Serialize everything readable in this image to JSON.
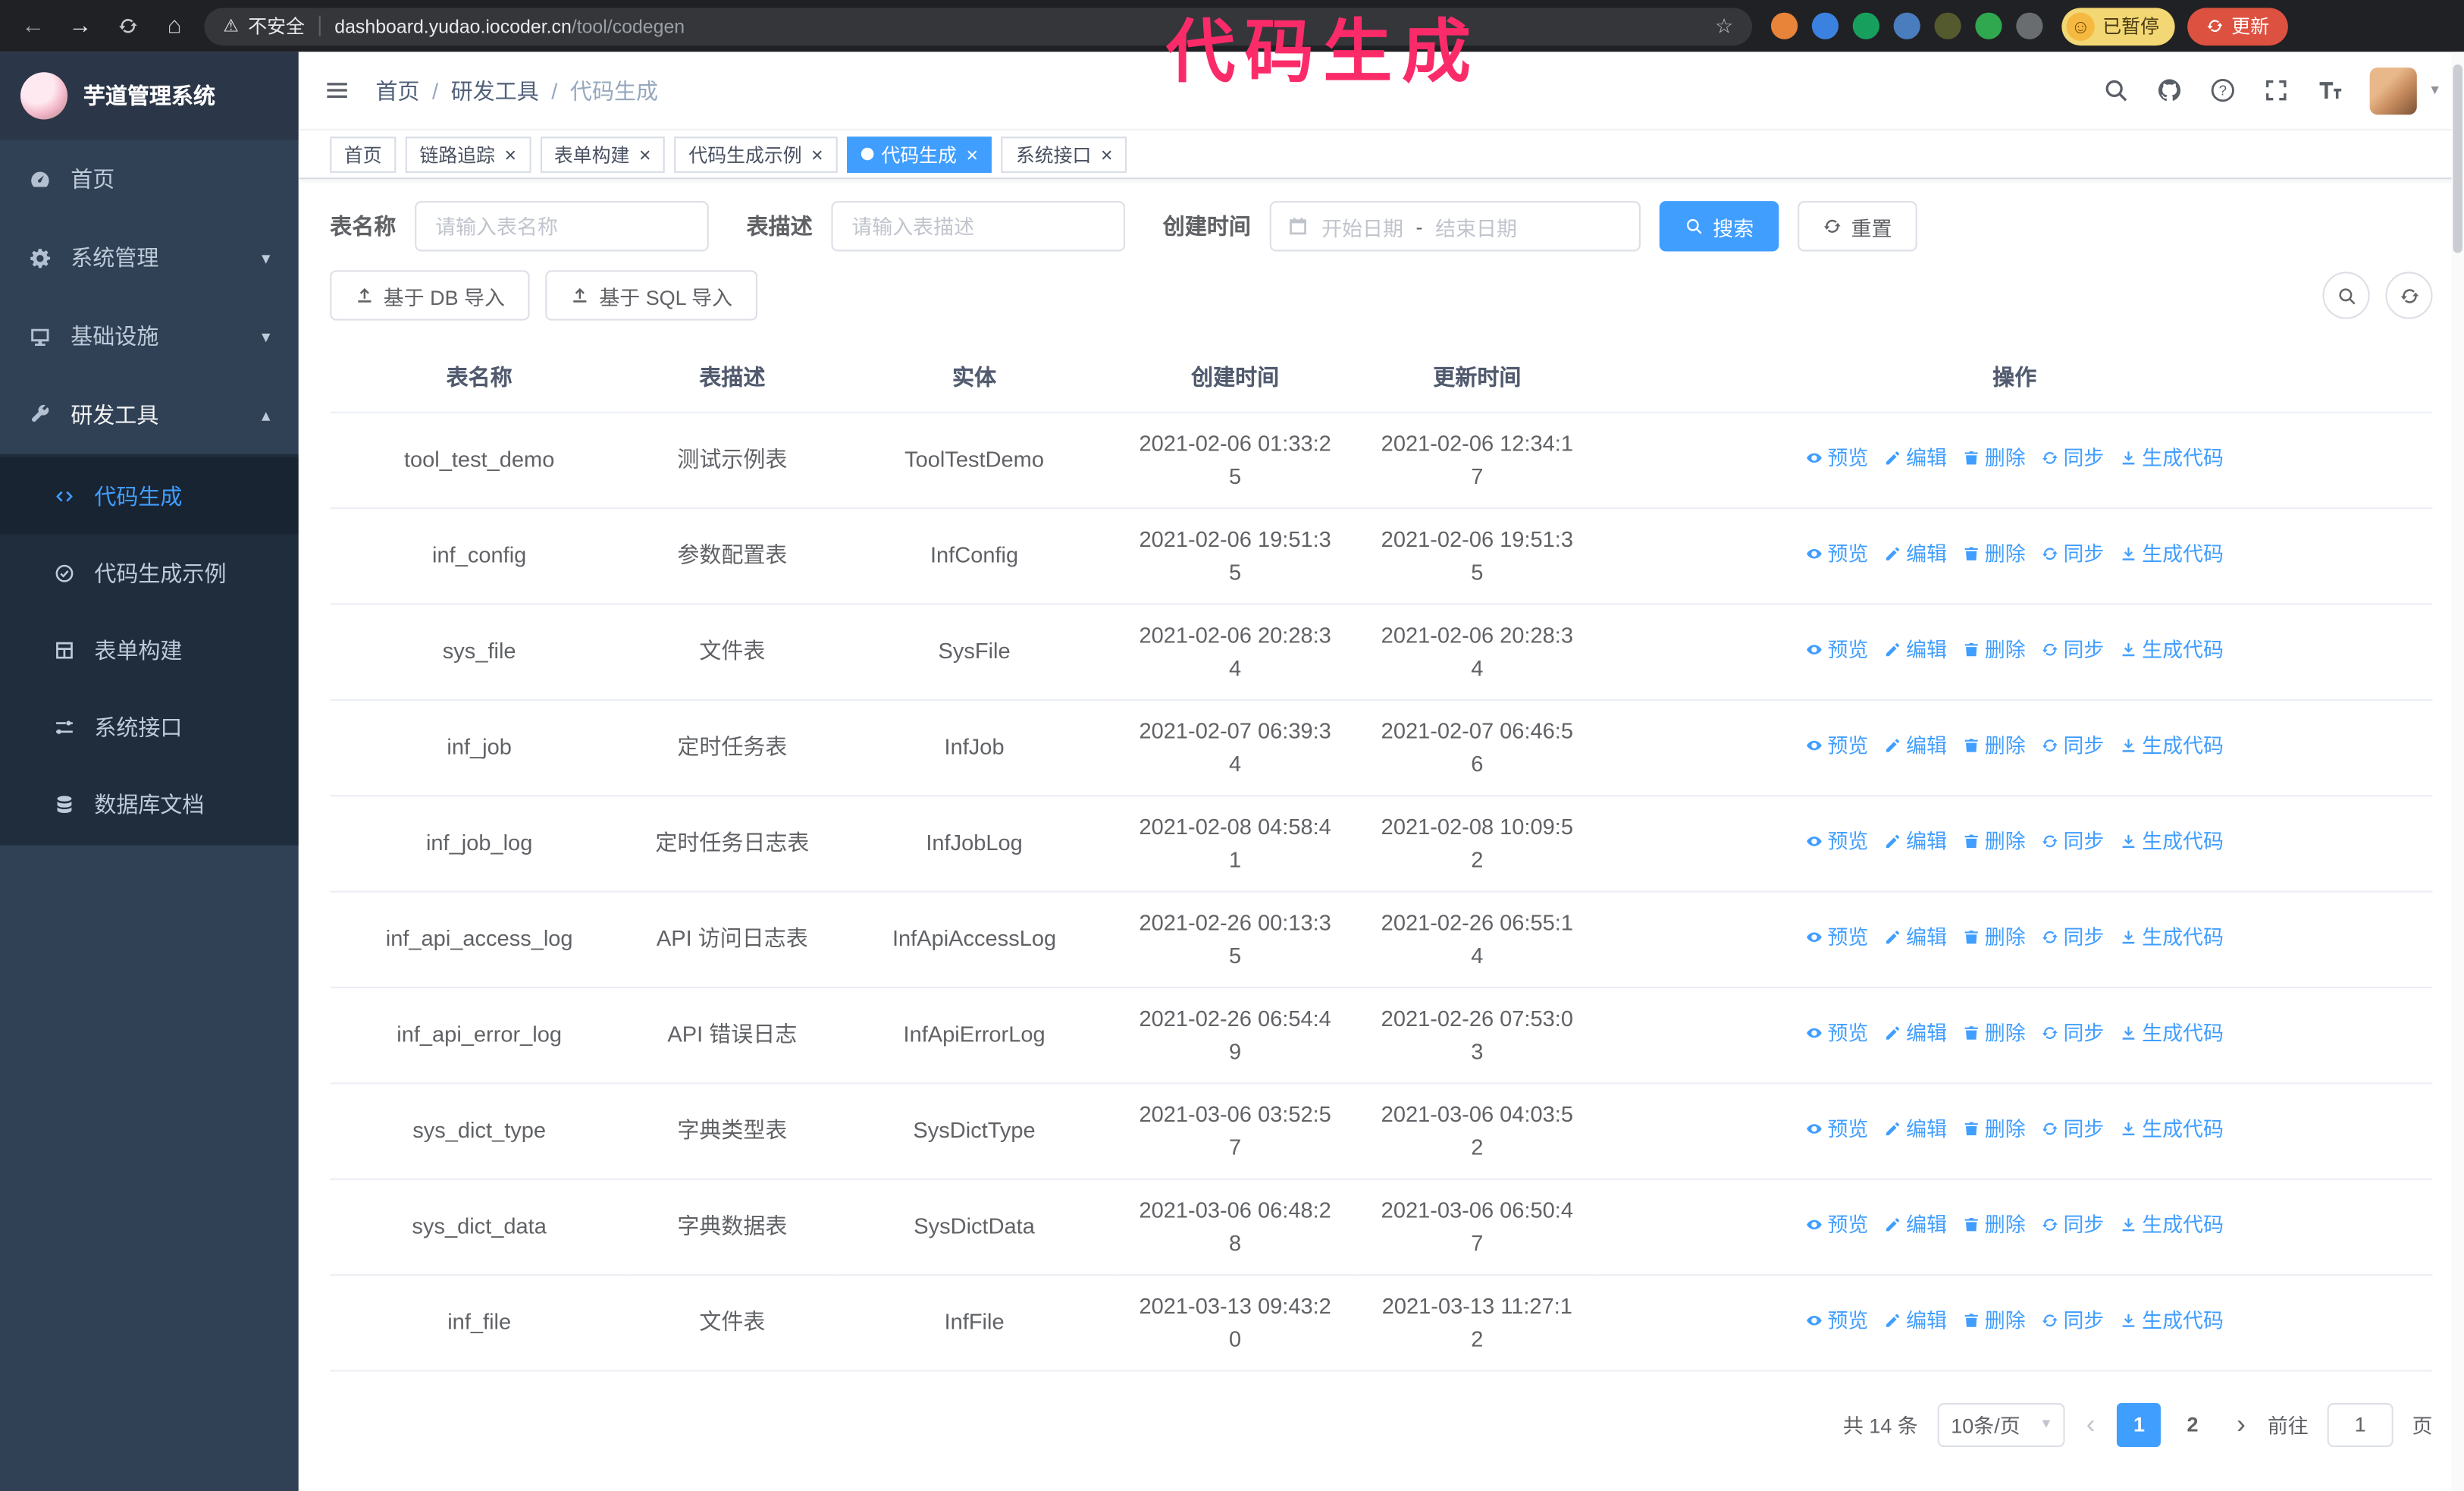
{
  "annotation": "代码生成",
  "browser": {
    "security_label": "不安全",
    "url_host": "dashboard.yudao.iocoder.cn",
    "url_path": "/tool/codegen",
    "paused_label": "已暂停",
    "update_label": "更新",
    "extensions": [
      {
        "name": "extension-fox-icon",
        "color": "#e8833a"
      },
      {
        "name": "extension-drop-icon",
        "color": "#3b82e0"
      },
      {
        "name": "extension-check-icon",
        "color": "#17a05d"
      },
      {
        "name": "extension-users-icon",
        "color": "#4a7dbd"
      },
      {
        "name": "extension-status-icon",
        "color": "#55592e"
      },
      {
        "name": "extension-leaf-icon",
        "color": "#2fa84f"
      },
      {
        "name": "extension-puzzle-icon",
        "color": "#6a6d70"
      }
    ]
  },
  "sidebar": {
    "logo_title": "芋道管理系统",
    "items": [
      {
        "key": "home",
        "label": "首页",
        "icon": "dashboard",
        "expandable": false,
        "expanded": false
      },
      {
        "key": "system",
        "label": "系统管理",
        "icon": "gear",
        "expandable": true,
        "expanded": false
      },
      {
        "key": "infra",
        "label": "基础设施",
        "icon": "monitor",
        "expandable": true,
        "expanded": false
      },
      {
        "key": "devtools",
        "label": "研发工具",
        "icon": "tools",
        "expandable": true,
        "expanded": true
      }
    ],
    "sub_items": [
      {
        "key": "codegen",
        "label": "代码生成",
        "icon": "code",
        "active": true
      },
      {
        "key": "codegen-example",
        "label": "代码生成示例",
        "icon": "badge",
        "active": false
      },
      {
        "key": "form-builder",
        "label": "表单构建",
        "icon": "form",
        "active": false
      },
      {
        "key": "system-api",
        "label": "系统接口",
        "icon": "sliders",
        "active": false
      },
      {
        "key": "db-doc",
        "label": "数据库文档",
        "icon": "database",
        "active": false
      }
    ]
  },
  "header": {
    "breadcrumb": [
      "首页",
      "研发工具",
      "代码生成"
    ]
  },
  "tabs": [
    {
      "key": "home",
      "label": "首页",
      "closable": false,
      "active": false
    },
    {
      "key": "tracer",
      "label": "链路追踪",
      "closable": true,
      "active": false
    },
    {
      "key": "form-builder",
      "label": "表单构建",
      "closable": true,
      "active": false
    },
    {
      "key": "codegen-example",
      "label": "代码生成示例",
      "closable": true,
      "active": false
    },
    {
      "key": "codegen",
      "label": "代码生成",
      "closable": true,
      "active": true
    },
    {
      "key": "system-api",
      "label": "系统接口",
      "closable": true,
      "active": false
    }
  ],
  "filters": {
    "table_name_label": "表名称",
    "table_name_placeholder": "请输入表名称",
    "table_desc_label": "表描述",
    "table_desc_placeholder": "请输入表描述",
    "create_time_label": "创建时间",
    "date_start_placeholder": "开始日期",
    "date_separator": "-",
    "date_end_placeholder": "结束日期",
    "search_label": "搜索",
    "reset_label": "重置"
  },
  "toolbar": {
    "import_db_label": "基于 DB 导入",
    "import_sql_label": "基于 SQL 导入"
  },
  "table": {
    "columns": [
      "表名称",
      "表描述",
      "实体",
      "创建时间",
      "更新时间",
      "操作"
    ],
    "actions": [
      {
        "key": "preview",
        "label": "预览",
        "icon": "eye"
      },
      {
        "key": "edit",
        "label": "编辑",
        "icon": "edit"
      },
      {
        "key": "delete",
        "label": "删除",
        "icon": "trash"
      },
      {
        "key": "sync",
        "label": "同步",
        "icon": "sync"
      },
      {
        "key": "generate",
        "label": "生成代码",
        "icon": "download"
      }
    ],
    "rows": [
      {
        "name": "tool_test_demo",
        "desc": "测试示例表",
        "entity": "ToolTestDemo",
        "created": "2021-02-06 01:33:25",
        "updated": "2021-02-06 12:34:17"
      },
      {
        "name": "inf_config",
        "desc": "参数配置表",
        "entity": "InfConfig",
        "created": "2021-02-06 19:51:35",
        "updated": "2021-02-06 19:51:35"
      },
      {
        "name": "sys_file",
        "desc": "文件表",
        "entity": "SysFile",
        "created": "2021-02-06 20:28:34",
        "updated": "2021-02-06 20:28:34"
      },
      {
        "name": "inf_job",
        "desc": "定时任务表",
        "entity": "InfJob",
        "created": "2021-02-07 06:39:34",
        "updated": "2021-02-07 06:46:56"
      },
      {
        "name": "inf_job_log",
        "desc": "定时任务日志表",
        "entity": "InfJobLog",
        "created": "2021-02-08 04:58:41",
        "updated": "2021-02-08 10:09:52"
      },
      {
        "name": "inf_api_access_log",
        "desc": "API 访问日志表",
        "entity": "InfApiAccessLog",
        "created": "2021-02-26 00:13:35",
        "updated": "2021-02-26 06:55:14"
      },
      {
        "name": "inf_api_error_log",
        "desc": "API 错误日志",
        "entity": "InfApiErrorLog",
        "created": "2021-02-26 06:54:49",
        "updated": "2021-02-26 07:53:03"
      },
      {
        "name": "sys_dict_type",
        "desc": "字典类型表",
        "entity": "SysDictType",
        "created": "2021-03-06 03:52:57",
        "updated": "2021-03-06 04:03:52"
      },
      {
        "name": "sys_dict_data",
        "desc": "字典数据表",
        "entity": "SysDictData",
        "created": "2021-03-06 06:48:28",
        "updated": "2021-03-06 06:50:47"
      },
      {
        "name": "inf_file",
        "desc": "文件表",
        "entity": "InfFile",
        "created": "2021-03-13 09:43:20",
        "updated": "2021-03-13 11:27:12"
      }
    ]
  },
  "pagination": {
    "total": "共 14 条",
    "page_size": "10条/页",
    "pages": [
      "1",
      "2"
    ],
    "active_page": "1",
    "goto_label": "前往",
    "goto_value": "1",
    "goto_unit": "页"
  },
  "colors": {
    "accent": "#409eff",
    "link": "#409eff",
    "sidebar_bg": "#304156",
    "submenu_bg": "#1f2d3d",
    "chrome_bg": "#202124",
    "annotation": "#fb2b69",
    "update_bg": "#dd5140",
    "paused_bg": "#f2d774"
  }
}
